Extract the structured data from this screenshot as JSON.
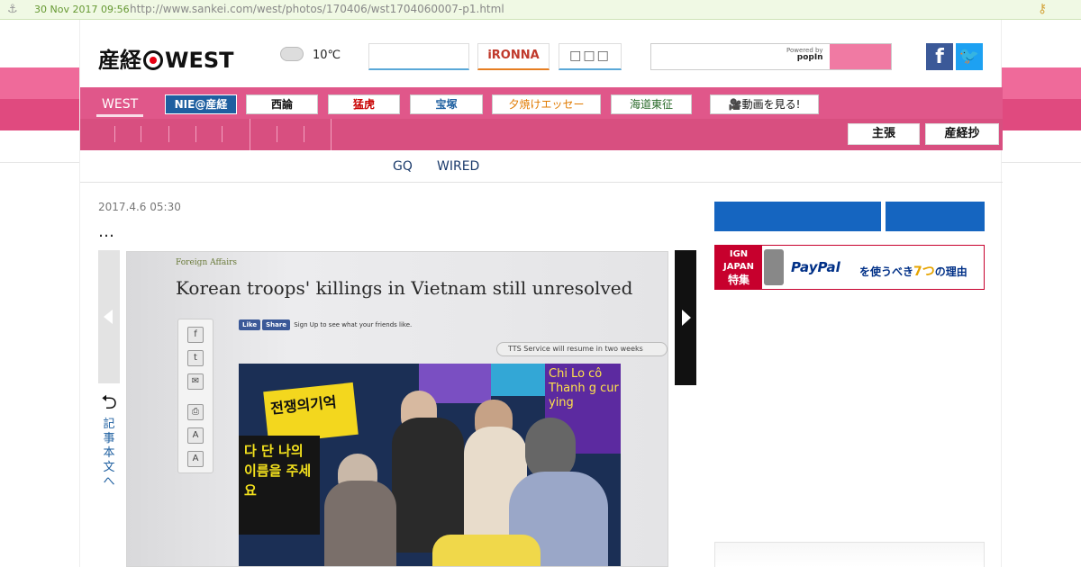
{
  "archive": {
    "date": "30 Nov 2017 09:56",
    "url": "http://www.sankei.com/west/photos/170406/wst1704060007-p1.html"
  },
  "header": {
    "logo_left": "産経",
    "logo_right": "WEST",
    "weather_temp": "10℃",
    "ironna_label": "iRONNA",
    "box_label": "□□□",
    "powered_by": "Powered by",
    "powered_brand": "popIn"
  },
  "nav": {
    "west_label": "WEST",
    "items": [
      {
        "label": "NIE@産経",
        "color": "#ffffff"
      },
      {
        "label": "西論",
        "color": "#111111"
      },
      {
        "label": "猛虎",
        "color": "#c80000"
      },
      {
        "label": "宝塚",
        "color": "#1e5fa0"
      },
      {
        "label": "夕焼けエッセー",
        "color": "#e07a00"
      },
      {
        "label": "海道東征",
        "color": "#2a6a2a"
      },
      {
        "label": "動画を見る!",
        "color": "#111111"
      }
    ],
    "right_buttons": [
      "主張",
      "産経抄"
    ]
  },
  "subnav": [
    "GQ",
    "WIRED"
  ],
  "article": {
    "date": "2017.4.6 05:30",
    "title": "…",
    "back_label": "記事本文へ"
  },
  "photo": {
    "section": "Foreign Affairs",
    "headline": "Korean troops' killings in Vietnam still unresolved",
    "like_label": "Like",
    "share_label": "Share",
    "signup_text": "Sign Up to see what your friends like.",
    "tts_text": "TTS Service will resume in two weeks",
    "sign1": "전쟁의기억",
    "sign2": "다 단 나의 이름을 주세요",
    "sign3": "Chi Lo cô Thanh g cur ying"
  },
  "ad": {
    "brand": "IGN JAPAN",
    "brand_sub": "特集",
    "paypal": "PayPal",
    "text_before": "を使うべき",
    "num": "7つ",
    "text_after": "の理由"
  }
}
